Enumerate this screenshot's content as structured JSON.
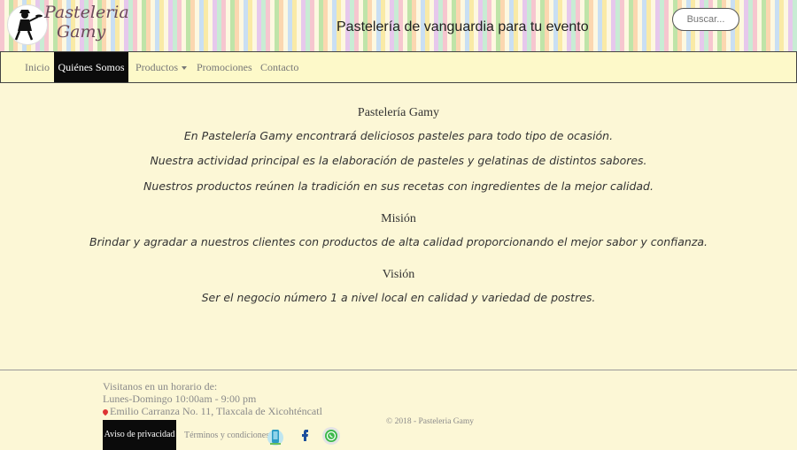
{
  "header": {
    "logo_line1": "Pasteleria",
    "logo_line2": "Gamy",
    "tagline": "Pastelería de vanguardia para tu evento",
    "search_placeholder": "Buscar..."
  },
  "nav": {
    "items": [
      {
        "label": "Inicio",
        "active": false
      },
      {
        "label": "Quiénes Somos",
        "active": true
      },
      {
        "label": "Productos",
        "active": false,
        "dropdown": true
      },
      {
        "label": "Promociones",
        "active": false
      },
      {
        "label": "Contacto",
        "active": false
      }
    ]
  },
  "main": {
    "about_title": "Pastelería Gamy",
    "about_p1": "En Pastelería Gamy encontrará deliciosos pasteles para todo tipo de ocasión.",
    "about_p2": "Nuestra actividad principal es la elaboración de pasteles y gelatinas de distintos sabores.",
    "about_p3": "Nuestros productos reúnen la tradición en sus recetas con ingredientes de la mejor calidad.",
    "mission_title": "Misión",
    "mission_text": "Brindar y agradar a nuestros clientes con productos de alta calidad proporcionando el mejor sabor y confianza.",
    "vision_title": "Visión",
    "vision_text": "Ser el negocio número 1 a nivel local en calidad y variedad de postres."
  },
  "footer": {
    "hours_label": "Visitanos en un horario de:",
    "hours": "Lunes-Domingo 10:00am - 9:00 pm",
    "address": "Emilio Carranza No. 11, Tlaxcala de Xicohténcatl",
    "privacy": "Aviso de privacidad",
    "terms": "Términos y condiciones",
    "copyright": "© 2018 - Pasteleria Gamy",
    "icons": [
      "phone-icon",
      "facebook-icon",
      "whatsapp-icon"
    ]
  },
  "colors": {
    "background": "#fcf7d6",
    "nav_background": "#fdf9c9",
    "nav_active": "#0b0b0b",
    "text_muted": "#8a8a8a"
  }
}
